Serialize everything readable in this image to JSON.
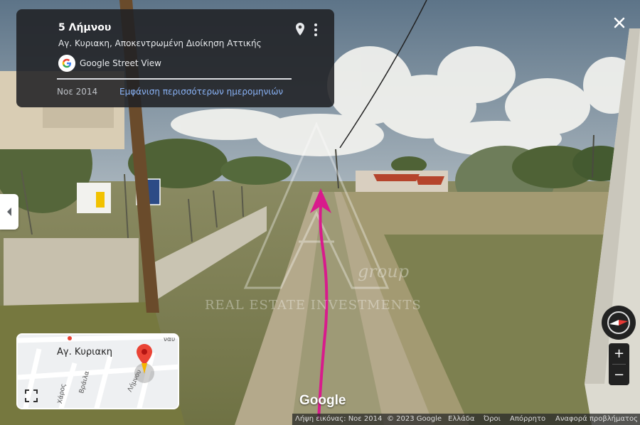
{
  "info_card": {
    "title": "5 Λήμνου",
    "subtitle": "Αγ. Κυριακη, Αποκεντρωμένη Διοίκηση Αττικής",
    "source": "Google Street View",
    "capture_date": "Νοε 2014",
    "more_dates_link": "Εμφάνιση περισσότερων ημερομηνιών"
  },
  "minimap": {
    "label": "Αγ. Κυριακη",
    "streets": [
      "Λήμνου",
      "Βράιλα",
      "Χάρος",
      "ναυ"
    ]
  },
  "controls": {
    "zoom_in": "+",
    "zoom_out": "−"
  },
  "google_logo": "Google",
  "watermark": {
    "text": "REAL ESTATE  INVESTMENTS",
    "group": "group"
  },
  "footer": {
    "capture": "Λήψη εικόνας: Νοε 2014",
    "copyright": "© 2023 Google",
    "country": "Ελλάδα",
    "terms": "Όροι",
    "privacy": "Απόρρητο",
    "report": "Αναφορά προβλήματος"
  },
  "colors": {
    "path_arrow": "#d81b8c",
    "card_bg": "#202124",
    "link": "#8ab4f8"
  }
}
